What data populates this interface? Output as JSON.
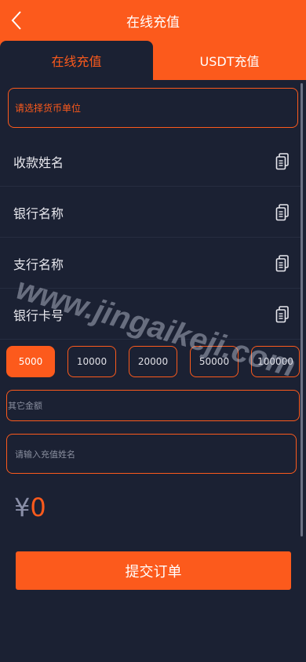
{
  "header": {
    "title": "在线充值"
  },
  "tabs": [
    {
      "label": "在线充值",
      "active": true
    },
    {
      "label": "USDT充值",
      "active": false
    }
  ],
  "currency_select": {
    "placeholder": "请选择货币单位"
  },
  "info_rows": [
    {
      "label": "收款姓名"
    },
    {
      "label": "银行名称"
    },
    {
      "label": "支行名称"
    },
    {
      "label": "银行卡号"
    }
  ],
  "amounts": [
    {
      "label": "5000",
      "selected": true
    },
    {
      "label": "10000",
      "selected": false
    },
    {
      "label": "20000",
      "selected": false
    },
    {
      "label": "50000",
      "selected": false
    },
    {
      "label": "100000",
      "selected": false
    }
  ],
  "other_amount": {
    "placeholder": "其它金额"
  },
  "name_input": {
    "placeholder": "请输入充值姓名"
  },
  "total": {
    "symbol": "¥",
    "value": "0"
  },
  "submit": {
    "label": "提交订单"
  },
  "watermark": {
    "text": "www.jingaikeji.com"
  },
  "colors": {
    "accent": "#fc5a1c",
    "background": "#1b2133"
  },
  "icons": {
    "back": "chevron-left-icon",
    "copy": "copy-icon"
  }
}
